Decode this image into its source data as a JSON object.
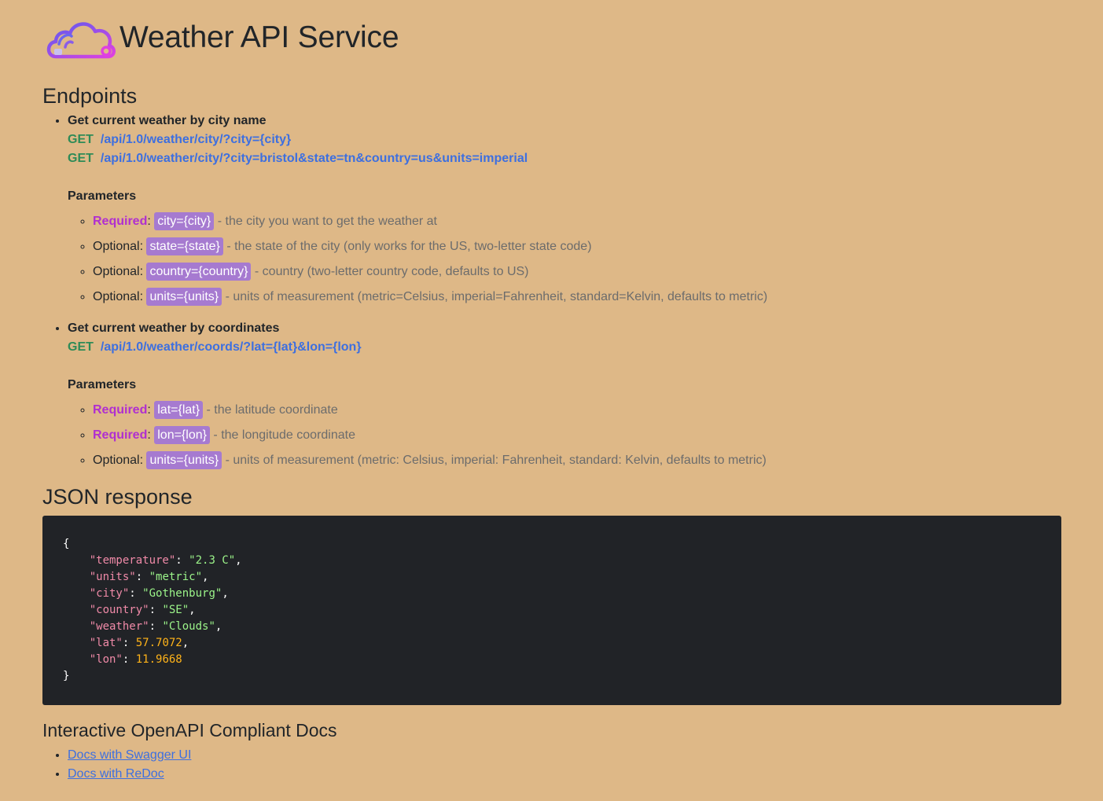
{
  "header": {
    "title": "Weather API Service",
    "logo_icon": "cloud-wifi-icon"
  },
  "sections": {
    "endpoints": "Endpoints",
    "json_response": "JSON response",
    "docs": "Interactive OpenAPI Compliant Docs"
  },
  "colors": {
    "background": "#deb887",
    "method": "#2e8b57",
    "path": "#3d6fe0",
    "required": "#b02fd0",
    "tag": "#a67ad0"
  },
  "endpoint1": {
    "title": "Get current weather by city name",
    "routes": [
      {
        "method": "GET",
        "path": "/api/1.0/weather/city/?city={city}"
      },
      {
        "method": "GET",
        "path": "/api/1.0/weather/city/?city=bristol&state=tn&country=us&units=imperial"
      }
    ],
    "params_title": "Parameters",
    "params": [
      {
        "level": "Required",
        "name": "city={city}",
        "desc": "- the city you want to get the weather at"
      },
      {
        "level": "Optional",
        "name": "state={state}",
        "desc": "- the state of the city (only works for the US, two-letter state code)"
      },
      {
        "level": "Optional",
        "name": "country={country}",
        "desc": "- country (two-letter country code, defaults to US)"
      },
      {
        "level": "Optional",
        "name": "units={units}",
        "desc": "- units of measurement (metric=Celsius, imperial=Fahrenheit, standard=Kelvin, defaults to metric)"
      }
    ]
  },
  "endpoint2": {
    "title": "Get current weather by coordinates",
    "routes": [
      {
        "method": "GET",
        "path": "/api/1.0/weather/coords/?lat={lat}&lon={lon}"
      }
    ],
    "params_title": "Parameters",
    "params": [
      {
        "level": "Required",
        "name": "lat={lat}",
        "desc": "- the latitude coordinate"
      },
      {
        "level": "Required",
        "name": "lon={lon}",
        "desc": "- the longitude coordinate"
      },
      {
        "level": "Optional",
        "name": "units={units}",
        "desc": "- units of measurement (metric: Celsius, imperial: Fahrenheit, standard: Kelvin, defaults to metric)"
      }
    ]
  },
  "json": {
    "open": "{",
    "close": "}",
    "lines": [
      {
        "key": "\"temperature\"",
        "value": "\"2.3 C\"",
        "vtype": "s",
        "comma": ","
      },
      {
        "key": "\"units\"",
        "value": "\"metric\"",
        "vtype": "s",
        "comma": ","
      },
      {
        "key": "\"city\"",
        "value": "\"Gothenburg\"",
        "vtype": "s",
        "comma": ","
      },
      {
        "key": "\"country\"",
        "value": "\"SE\"",
        "vtype": "s",
        "comma": ","
      },
      {
        "key": "\"weather\"",
        "value": "\"Clouds\"",
        "vtype": "s",
        "comma": ","
      },
      {
        "key": "\"lat\"",
        "value": "57.7072",
        "vtype": "n",
        "comma": ","
      },
      {
        "key": "\"lon\"",
        "value": "11.9668",
        "vtype": "n",
        "comma": ""
      }
    ]
  },
  "docs": {
    "links": [
      {
        "label": "Docs with Swagger UI"
      },
      {
        "label": "Docs with ReDoc"
      }
    ]
  }
}
